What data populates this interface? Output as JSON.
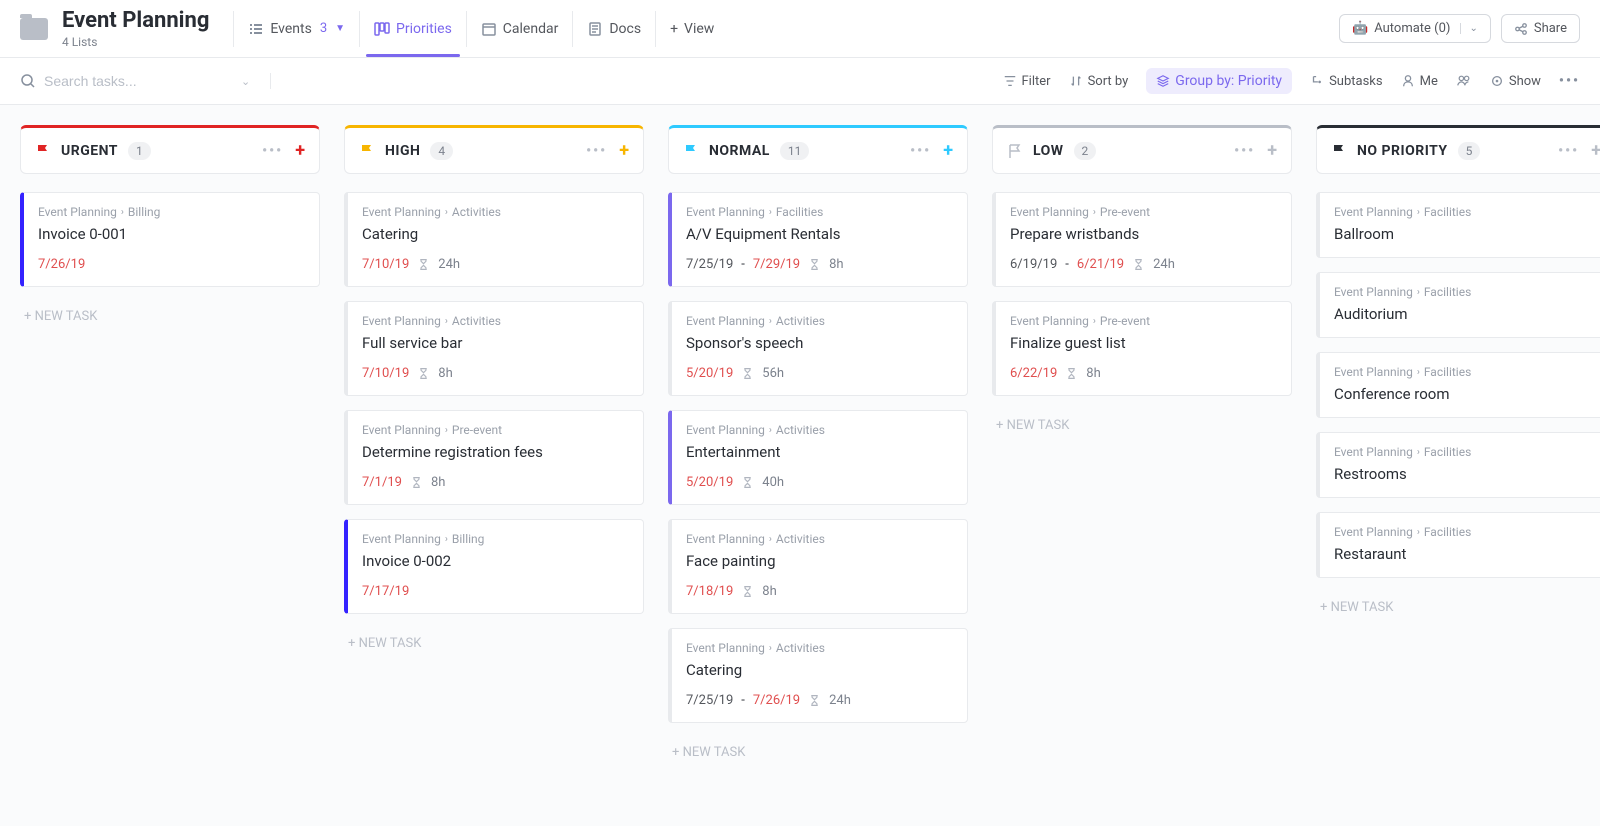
{
  "header": {
    "title": "Event Planning",
    "subtitle": "4 Lists",
    "views": {
      "events": {
        "label": "Events",
        "count": "3"
      },
      "priorities": {
        "label": "Priorities"
      },
      "calendar": {
        "label": "Calendar"
      },
      "docs": {
        "label": "Docs"
      },
      "add": {
        "label": "View"
      }
    },
    "automate": "Automate (0)",
    "share": "Share"
  },
  "toolbar": {
    "search_placeholder": "Search tasks...",
    "filter": "Filter",
    "sort": "Sort by",
    "group": "Group by: Priority",
    "subtasks": "Subtasks",
    "me": "Me",
    "show": "Show"
  },
  "board": {
    "new_task": "+ NEW TASK",
    "columns": [
      {
        "id": "urgent",
        "title": "URGENT",
        "count": "1",
        "color": "#e02424",
        "cards": [
          {
            "crumb1": "Event Planning",
            "crumb2": "Billing",
            "title": "Invoice 0-001",
            "date1": "7/26/19",
            "overdue1": true,
            "accent": "urgent"
          }
        ]
      },
      {
        "id": "high",
        "title": "HIGH",
        "count": "4",
        "color": "#f7b500",
        "cards": [
          {
            "crumb1": "Event Planning",
            "crumb2": "Activities",
            "title": "Catering",
            "date1": "7/10/19",
            "overdue1": true,
            "hours": "24h"
          },
          {
            "crumb1": "Event Planning",
            "crumb2": "Activities",
            "title": "Full service bar",
            "date1": "7/10/19",
            "overdue1": true,
            "hours": "8h"
          },
          {
            "crumb1": "Event Planning",
            "crumb2": "Pre-event",
            "title": "Determine registration fees",
            "date1": "7/1/19",
            "overdue1": true,
            "hours": "8h"
          },
          {
            "crumb1": "Event Planning",
            "crumb2": "Billing",
            "title": "Invoice 0-002",
            "date1": "7/17/19",
            "overdue1": true,
            "accent": "urgent"
          }
        ]
      },
      {
        "id": "normal",
        "title": "NORMAL",
        "count": "11",
        "color": "#2ecaff",
        "cards": [
          {
            "crumb1": "Event Planning",
            "crumb2": "Facilities",
            "title": "A/V Equipment Rentals",
            "date1": "7/25/19",
            "date2": "7/29/19",
            "overdue2": true,
            "hours": "8h",
            "accent": "purple"
          },
          {
            "crumb1": "Event Planning",
            "crumb2": "Activities",
            "title": "Sponsor's speech",
            "date1": "5/20/19",
            "overdue1": true,
            "hours": "56h"
          },
          {
            "crumb1": "Event Planning",
            "crumb2": "Activities",
            "title": "Entertainment",
            "date1": "5/20/19",
            "overdue1": true,
            "hours": "40h",
            "accent": "purple"
          },
          {
            "crumb1": "Event Planning",
            "crumb2": "Activities",
            "title": "Face painting",
            "date1": "7/18/19",
            "overdue1": true,
            "hours": "8h"
          },
          {
            "crumb1": "Event Planning",
            "crumb2": "Activities",
            "title": "Catering",
            "date1": "7/25/19",
            "date2": "7/26/19",
            "overdue2": true,
            "hours": "24h"
          }
        ]
      },
      {
        "id": "low",
        "title": "LOW",
        "count": "2",
        "color": "#b9bec7",
        "cards": [
          {
            "crumb1": "Event Planning",
            "crumb2": "Pre-event",
            "title": "Prepare wristbands",
            "date1": "6/19/19",
            "date2": "6/21/19",
            "overdue2": true,
            "hours": "24h"
          },
          {
            "crumb1": "Event Planning",
            "crumb2": "Pre-event",
            "title": "Finalize guest list",
            "date1": "6/22/19",
            "overdue1": true,
            "hours": "8h"
          }
        ]
      },
      {
        "id": "none",
        "title": "NO PRIORITY",
        "count": "5",
        "color": "#292d34",
        "cards": [
          {
            "crumb1": "Event Planning",
            "crumb2": "Facilities",
            "title": "Ballroom"
          },
          {
            "crumb1": "Event Planning",
            "crumb2": "Facilities",
            "title": "Auditorium"
          },
          {
            "crumb1": "Event Planning",
            "crumb2": "Facilities",
            "title": "Conference room"
          },
          {
            "crumb1": "Event Planning",
            "crumb2": "Facilities",
            "title": "Restrooms"
          },
          {
            "crumb1": "Event Planning",
            "crumb2": "Facilities",
            "title": "Restaraunt"
          }
        ]
      }
    ]
  }
}
